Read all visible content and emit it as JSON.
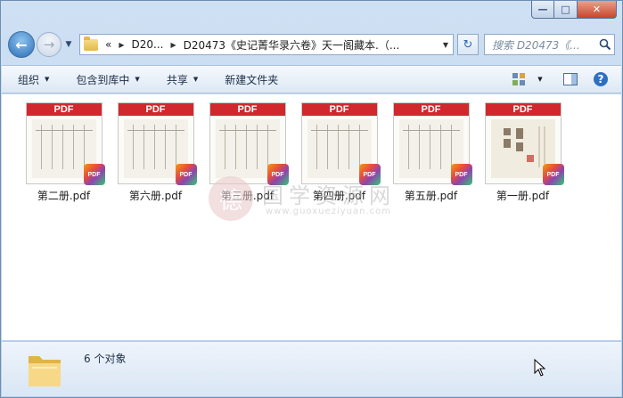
{
  "window": {
    "controls": {
      "minimize": "—",
      "maximize": "□",
      "close": "✕"
    }
  },
  "nav": {
    "back_icon": "←",
    "forward_icon": "→",
    "history_dropdown": "▼",
    "breadcrumb": {
      "overflow": "«",
      "items": [
        "D20...",
        "D20473《史记菁华录六卷》天一阁藏本.（..."
      ]
    },
    "refresh_icon": "↻",
    "search_placeholder": "搜索 D20473《..."
  },
  "toolbar": {
    "organize": "组织",
    "include_in_library": "包含到库中",
    "share": "共享",
    "new_folder": "新建文件夹"
  },
  "files": [
    {
      "name": "第二册.pdf",
      "tag": "PDF"
    },
    {
      "name": "第六册.pdf",
      "tag": "PDF"
    },
    {
      "name": "第三册.pdf",
      "tag": "PDF"
    },
    {
      "name": "第四册.pdf",
      "tag": "PDF"
    },
    {
      "name": "第五册.pdf",
      "tag": "PDF"
    },
    {
      "name": "第一册.pdf",
      "tag": "PDF"
    }
  ],
  "badge_label": "PDF",
  "watermark": {
    "seal": "德",
    "title": "国学资源网",
    "url": "www.guoxueziyuan.com"
  },
  "status": {
    "count_text": "6 个对象"
  },
  "colors": {
    "pdf_band": "#d0282d",
    "window_frame": "#b9d1ec",
    "close_button": "#c8452a"
  }
}
